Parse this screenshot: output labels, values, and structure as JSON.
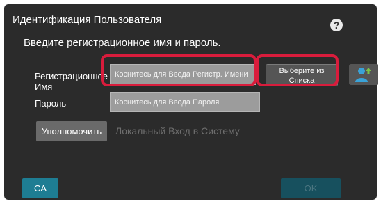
{
  "dialog": {
    "title": "Идентификация Пользователя",
    "help_icon": "question-mark-icon",
    "instruction": "Введите регистрационное имя и пароль."
  },
  "form": {
    "login_label": "Регистрационное\nИмя",
    "login_placeholder": "Коснитесь для Ввода Регистр. Имени",
    "select_from_list_label": "Выберите из Списка",
    "user_icon": "user-add-icon",
    "password_label": "Пароль",
    "password_placeholder": "Коснитесь для Ввода Пароля",
    "authorize_label": "Уполномочить",
    "local_login_label": "Локальный Вход в Систему"
  },
  "footer": {
    "ca_label": "CA",
    "ok_label": "OK"
  },
  "colors": {
    "panel_bg": "#2b2b2b",
    "highlight_ring": "#d91c3c",
    "accent_teal": "#1e7d93",
    "ok_disabled": "#17505e"
  }
}
